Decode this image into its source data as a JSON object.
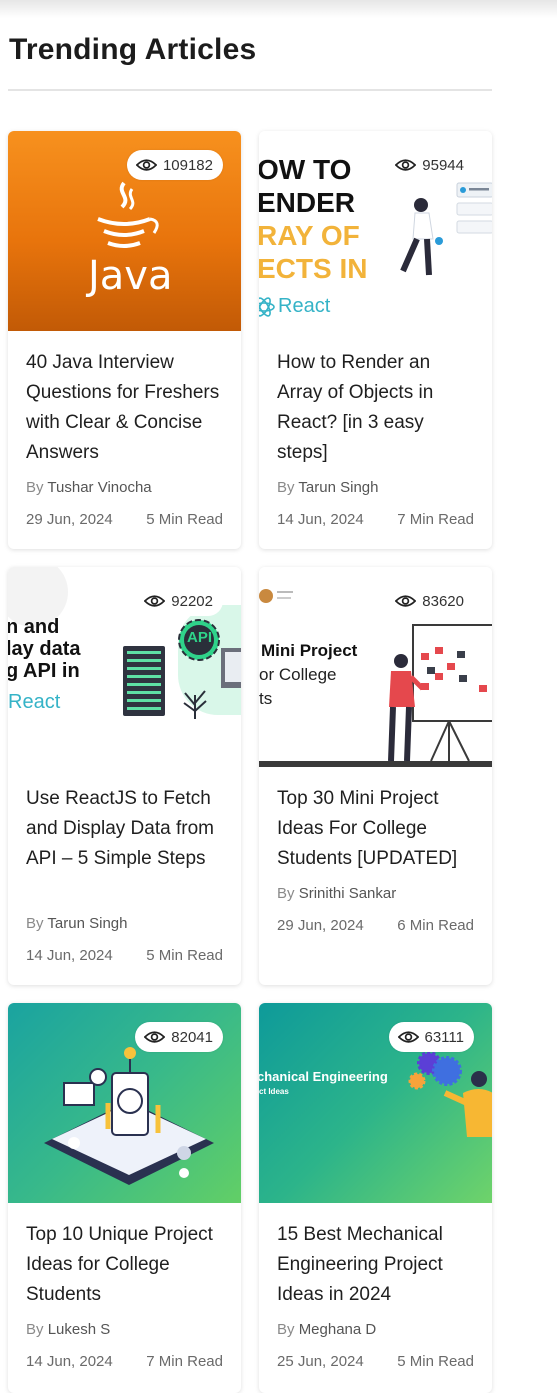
{
  "section": {
    "title": "Trending Articles"
  },
  "cards": [
    {
      "views": "109182",
      "thumb_logo_text": "Java",
      "title": "40 Java Interview Questions for Freshers with Clear & Concise Answers",
      "by": "By",
      "author": "Tushar Vinocha",
      "date": "29 Jun, 2024",
      "read": "5 Min Read"
    },
    {
      "views": "95944",
      "thumb_lines": [
        "OW TO",
        "ENDER",
        "RAY OF",
        "ECTS IN"
      ],
      "thumb_brand": "React",
      "title": "How to Render an Array of Objects in React? [in 3 easy steps]",
      "by": "By",
      "author": "Tarun Singh",
      "date": "14 Jun, 2024",
      "read": "7 Min Read"
    },
    {
      "views": "92202",
      "thumb_lines": [
        "n and",
        "lay data",
        "g API in"
      ],
      "thumb_brand": "React",
      "thumb_badge": "API",
      "title": "Use ReactJS to Fetch and Display Data from API – 5 Simple Steps",
      "by": "By",
      "author": "Tarun Singh",
      "date": "14 Jun, 2024",
      "read": "5 Min Read"
    },
    {
      "views": "83620",
      "thumb_lines": [
        "Mini Project",
        "or College",
        "ts"
      ],
      "title": "Top 30 Mini Project Ideas For College Students [UPDATED]",
      "by": "By",
      "author": "Srinithi Sankar",
      "date": "29 Jun, 2024",
      "read": "6 Min Read"
    },
    {
      "views": "82041",
      "title": "Top 10 Unique Project Ideas for College Students",
      "by": "By",
      "author": "Lukesh S",
      "date": "14 Jun, 2024",
      "read": "7 Min Read"
    },
    {
      "views": "63111",
      "thumb_lines": [
        "chanical Engineering",
        "ct Ideas"
      ],
      "title": "15 Best Mechanical Engineering Project Ideas in 2024",
      "by": "By",
      "author": "Meghana D",
      "date": "25 Jun, 2024",
      "read": "5 Min Read"
    }
  ],
  "icons": {
    "views": "eye-icon"
  },
  "colors": {
    "java_orange": "#f07f10",
    "react_teal": "#3aa0a8",
    "green_grad": "#4bc96a"
  }
}
